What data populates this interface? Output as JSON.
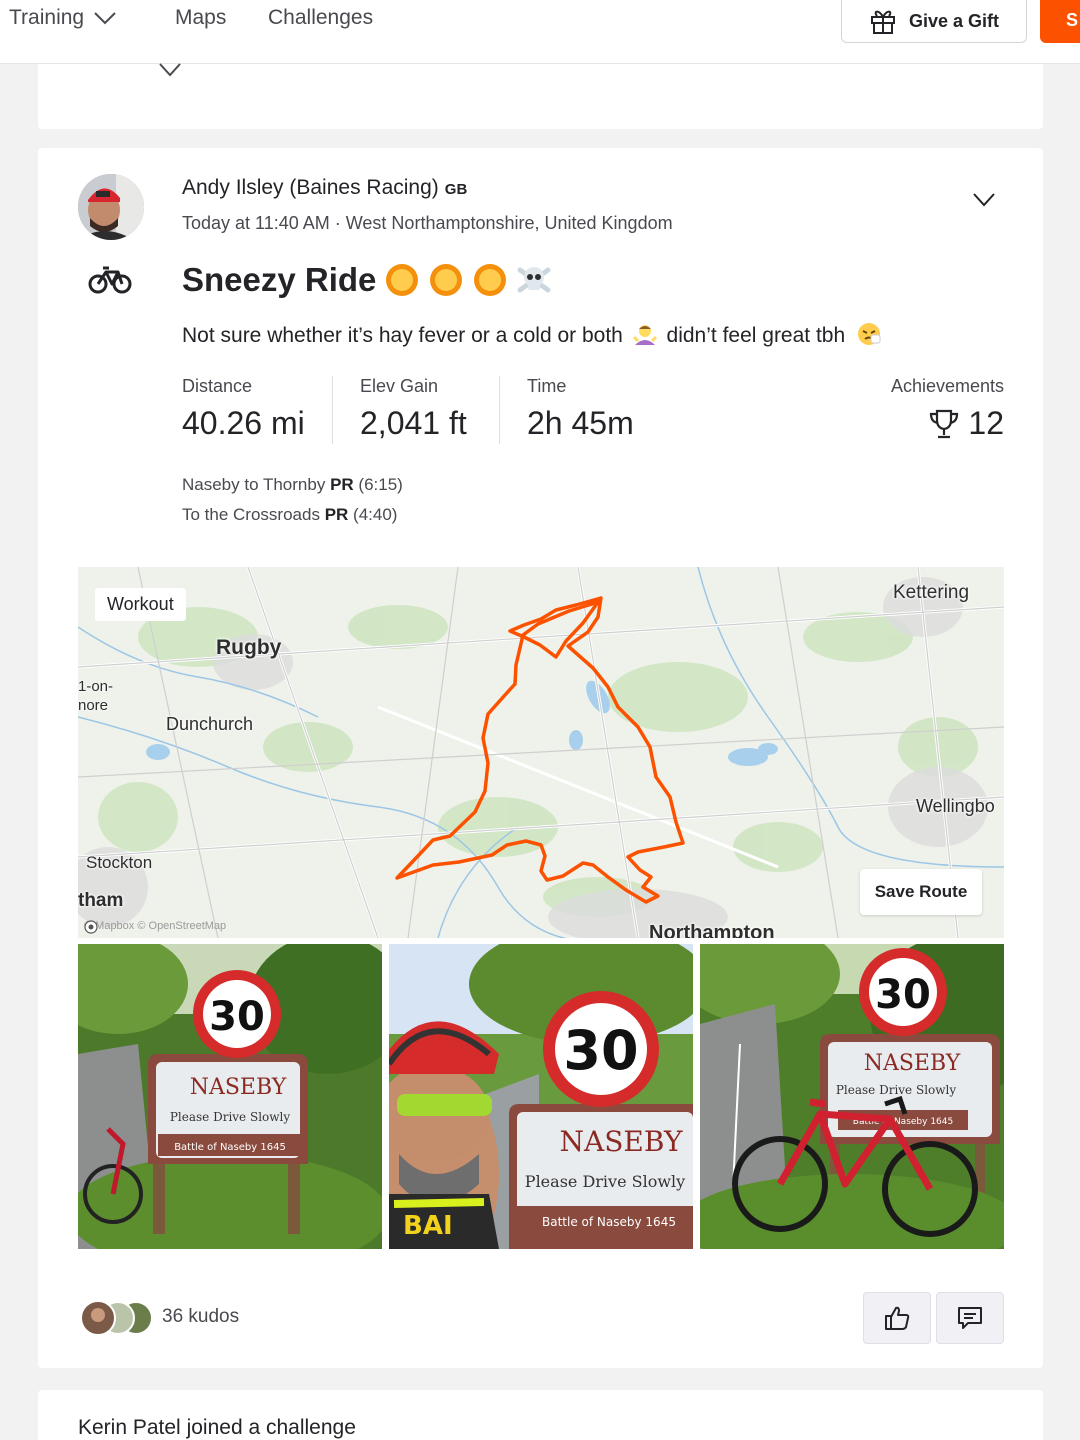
{
  "nav": {
    "items": [
      {
        "label": "Training"
      },
      {
        "label": "Maps"
      },
      {
        "label": "Challenges"
      }
    ],
    "gift_label": "Give a Gift",
    "subscribe_label": "S",
    "accent": "#fc5200"
  },
  "activity": {
    "athlete_name": "Andy Ilsley (Baines Racing)",
    "country": "GB",
    "meta": "Today at 11:40 AM · West Northamptonshire, United Kingdom",
    "title": "Sneezy Ride",
    "title_emojis": [
      "sun-emoji",
      "sun-emoji",
      "sun-emoji",
      "skull-crossbones-emoji"
    ],
    "description_part1": "Not sure whether it’s hay fever or a cold or both",
    "description_part2": "didn’t feel great tbh",
    "stats": [
      {
        "label": "Distance",
        "value": "40.26 mi"
      },
      {
        "label": "Elev Gain",
        "value": "2,041 ft"
      },
      {
        "label": "Time",
        "value": "2h 45m"
      }
    ],
    "achievements": {
      "label": "Achievements",
      "value": "12"
    },
    "segments": [
      {
        "name": "Naseby to Thornby",
        "badge": "PR",
        "time": "(6:15)"
      },
      {
        "name": "To the Crossroads",
        "badge": "PR",
        "time": "(4:40)"
      }
    ]
  },
  "map": {
    "workout_label": "Workout",
    "places": {
      "kettering": "Kettering",
      "rugby": "Rugby",
      "on": "1-on-",
      "more": "nore",
      "dunchurch": "Dunchurch",
      "wellingbo": "Wellingbo",
      "stockton": "Stockton",
      "tham": "tham",
      "northampton": "Northampton"
    },
    "save_route_label": "Save Route",
    "attribution": "© Mapbox © OpenStreetMap",
    "route_color": "#fc5200"
  },
  "photos": {
    "sign_number": "30",
    "sign_town": "NASEBY",
    "sign_sub": "Please Drive Slowly",
    "sign_battle": "Battle of Naseby 1645",
    "jersey_text": "BAI"
  },
  "footer": {
    "kudos_text": "36 kudos"
  },
  "next": {
    "name": "Kerin Patel",
    "action": " joined a challenge"
  }
}
